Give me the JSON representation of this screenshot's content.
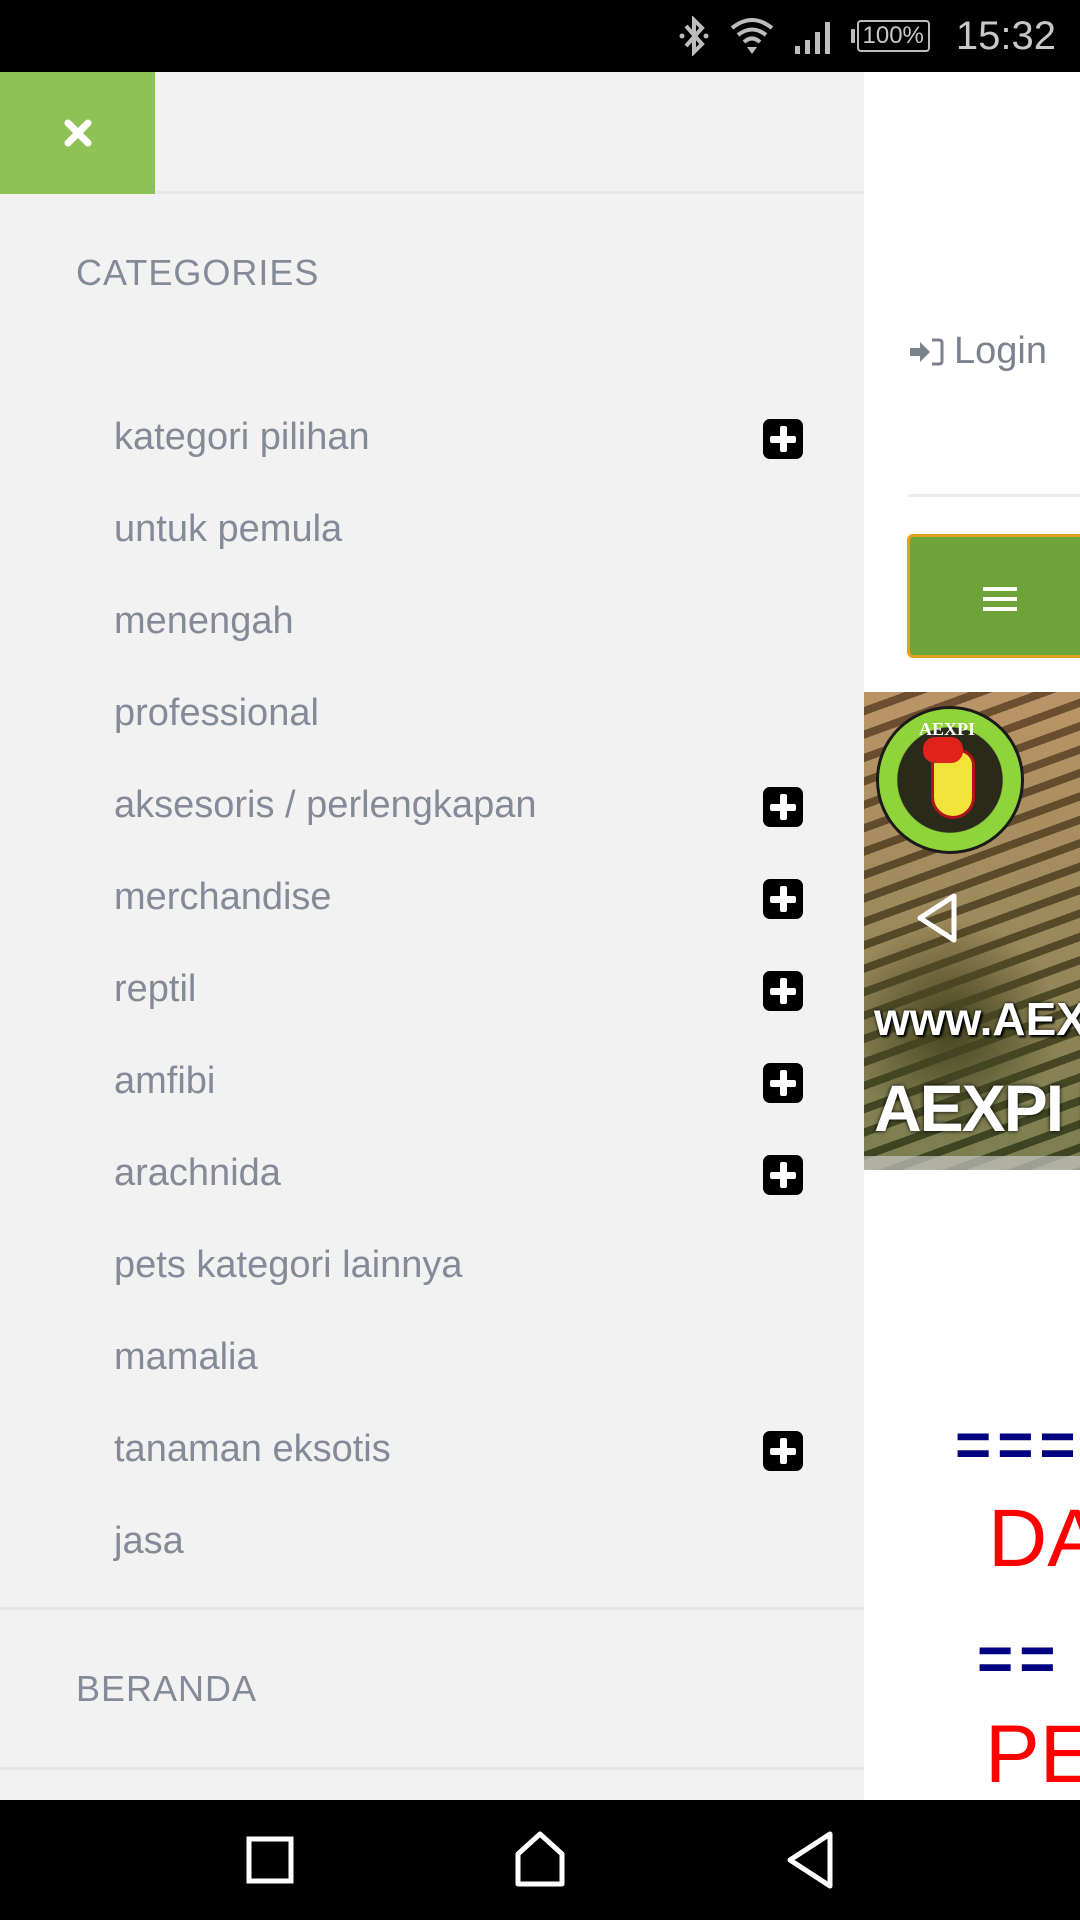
{
  "status_bar": {
    "icons": [
      "bluetooth-icon",
      "wifi-icon",
      "signal-icon",
      "battery-icon"
    ],
    "battery": "100%",
    "time": "15:32"
  },
  "drawer": {
    "close_icon": "close-icon",
    "accent_color": "#8fc255",
    "categories_title": "CATEGORIES",
    "categories": [
      {
        "label": "kategori pilihan",
        "expandable": true
      },
      {
        "label": "untuk pemula",
        "expandable": false
      },
      {
        "label": "menengah",
        "expandable": false
      },
      {
        "label": "professional",
        "expandable": false
      },
      {
        "label": "aksesoris / perlengkapan",
        "expandable": true
      },
      {
        "label": "merchandise",
        "expandable": true
      },
      {
        "label": "reptil",
        "expandable": true
      },
      {
        "label": "amfibi",
        "expandable": true
      },
      {
        "label": "arachnida",
        "expandable": true
      },
      {
        "label": "pets kategori lainnya",
        "expandable": false
      },
      {
        "label": "mamalia",
        "expandable": false
      },
      {
        "label": "tanaman eksotis",
        "expandable": true
      },
      {
        "label": "jasa",
        "expandable": false
      }
    ],
    "home_title": "BERANDA"
  },
  "page": {
    "login_label": "Login",
    "menu_toggle_color": "#6ea33a",
    "banner": {
      "logo_text": "AEXPI",
      "url_text": "www.AEX",
      "title_text": "AEXPI I"
    },
    "promo": {
      "line1": "===",
      "red1": "DA",
      "line2": "==",
      "red2": "PE"
    }
  },
  "nav_bar": {
    "buttons": [
      "recents-icon",
      "home-icon",
      "back-icon"
    ]
  }
}
